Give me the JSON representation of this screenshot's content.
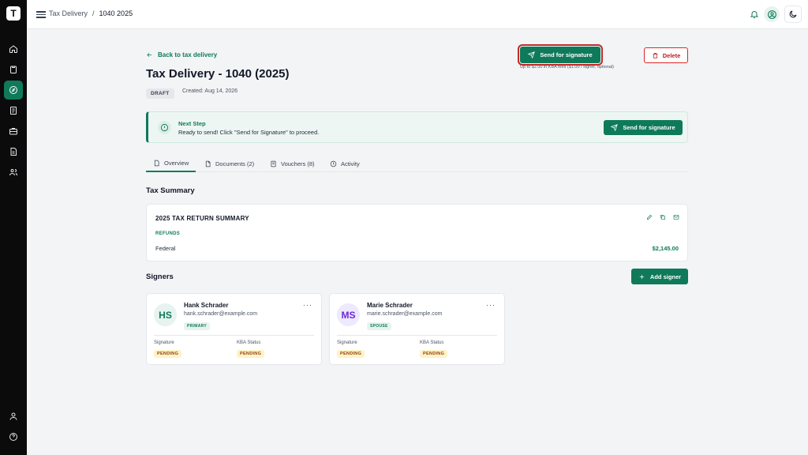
{
  "app": {
    "logo_text": "T",
    "accent_color": "#0f7a5a",
    "danger_color": "#dc2626"
  },
  "topbar": {
    "breadcrumb": [
      "Tax Delivery",
      "1040 2025"
    ],
    "separator": "/"
  },
  "sidebar": {
    "items": [
      {
        "icon": "home-icon",
        "active": false
      },
      {
        "icon": "clipboard-icon",
        "active": false
      },
      {
        "icon": "compass-icon",
        "active": true
      },
      {
        "icon": "receipt-icon",
        "active": false
      },
      {
        "icon": "briefcase-icon",
        "active": false
      },
      {
        "icon": "document-icon",
        "active": false
      },
      {
        "icon": "users-icon",
        "active": false
      }
    ],
    "bottom": [
      {
        "icon": "user-icon"
      },
      {
        "icon": "help-icon"
      }
    ]
  },
  "header": {
    "back_link": "Back to tax delivery",
    "title": "Tax Delivery - 1040 (2025)",
    "status": "DRAFT",
    "created": "Created: Aug 14, 2026",
    "send_button": "Send for signature",
    "fee_note": "Up to $2.00 in KBA fees ($1.00 / signer, optional)",
    "delete_button": "Delete"
  },
  "next_step": {
    "title": "Next Step",
    "text": "Ready to send! Click \"Send for Signature\" to proceed.",
    "button": "Send for signature"
  },
  "tabs": [
    {
      "label": "Overview",
      "active": true
    },
    {
      "label": "Documents (2)",
      "active": false
    },
    {
      "label": "Vouchers (8)",
      "active": false
    },
    {
      "label": "Activity",
      "active": false
    }
  ],
  "tax_summary": {
    "section_title": "Tax Summary",
    "card_title": "2025 TAX RETURN SUMMARY",
    "refunds_label": "REFUNDS",
    "federal_label": "Federal",
    "federal_amount": "$2,145.00"
  },
  "signers": {
    "section_title": "Signers",
    "add_button": "Add signer",
    "items": [
      {
        "initials": "HS",
        "name": "Hank Schrader",
        "email": "hank.schrader@example.com",
        "role": "PRIMARY",
        "signature_label": "Signature",
        "signature_status": "PENDING",
        "kba_label": "KBA Status",
        "kba_status": "PENDING",
        "more": "···"
      },
      {
        "initials": "MS",
        "name": "Marie Schrader",
        "email": "marie.schrader@example.com",
        "role": "SPOUSE",
        "signature_label": "Signature",
        "signature_status": "PENDING",
        "kba_label": "KBA Status",
        "kba_status": "PENDING",
        "more": "···"
      }
    ]
  }
}
